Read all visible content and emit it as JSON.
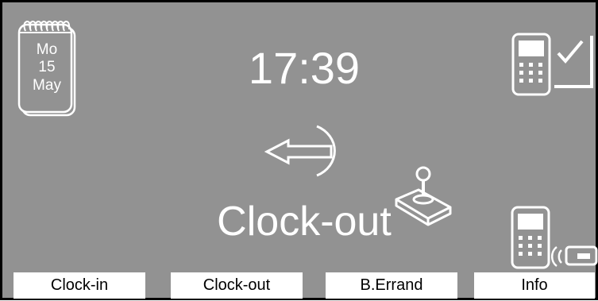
{
  "calendar": {
    "day_name": "Mo",
    "day_number": "15",
    "month": "May"
  },
  "clock": {
    "time": "17:39"
  },
  "mode": {
    "label": "Clock-out"
  },
  "icons": {
    "calendar": "calendar-icon",
    "terminal_confirm": "terminal-check-icon",
    "direction": "arrow-left-icon",
    "joystick": "joystick-icon",
    "terminal_card": "terminal-card-reader-icon"
  },
  "softkeys": [
    {
      "label": "Clock-in"
    },
    {
      "label": "Clock-out"
    },
    {
      "label": "B.Errand"
    },
    {
      "label": "Info"
    }
  ],
  "colors": {
    "background": "#929292",
    "foreground": "#ffffff",
    "button_bg": "#ffffff",
    "button_text": "#000000"
  }
}
